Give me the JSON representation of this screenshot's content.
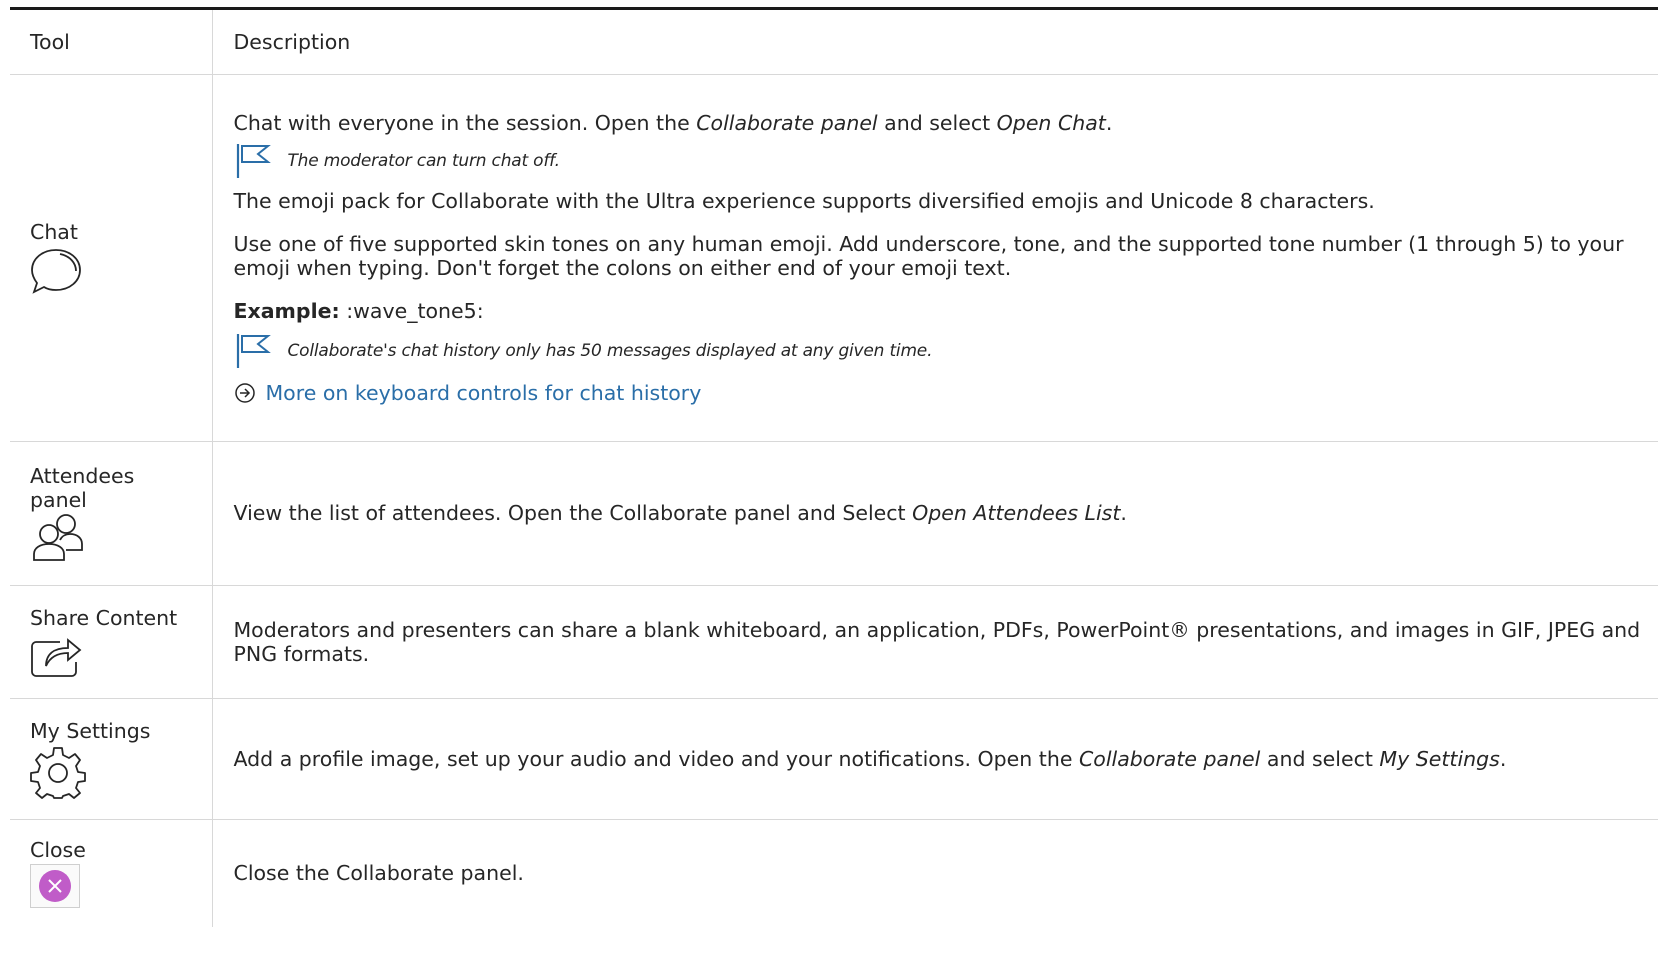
{
  "table": {
    "headers": {
      "tool": "Tool",
      "description": "Description"
    },
    "chat": {
      "tool": "Chat",
      "p1_a": "Chat with everyone in the session. Open the ",
      "p1_b": "Collaborate panel",
      "p1_c": " and select ",
      "p1_d": "Open Chat",
      "p1_e": ".",
      "note1": "The moderator can turn chat off.",
      "p2": "The emoji pack for Collaborate with the Ultra experience supports diversified emojis and Unicode 8 characters.",
      "p3": "Use one of five supported skin tones on any human emoji. Add underscore, tone, and the supported tone number (1 through 5) to your emoji when typing. Don't forget the colons on either end of your emoji text.",
      "example_label": "Example:",
      "example_value": " :wave_tone5:",
      "note2": "Collaborate's chat history only has 50 messages displayed at any given time.",
      "link": "More on keyboard controls for chat history"
    },
    "attendees": {
      "tool_line1": "Attendees",
      "tool_line2": "panel",
      "desc_a": "View the list of attendees. Open the Collaborate panel and Select ",
      "desc_b": "Open Attendees List",
      "desc_c": "."
    },
    "share": {
      "tool": "Share Content",
      "desc": "Moderators and presenters can share a blank whiteboard, an application, PDFs, PowerPoint® presentations, and images in GIF, JPEG and PNG formats."
    },
    "settings": {
      "tool": "My Settings",
      "desc_a": "Add a profile image, set up your audio and video and your notifications. Open the ",
      "desc_b": "Collaborate panel",
      "desc_c": " and select ",
      "desc_d": "My Settings",
      "desc_e": "."
    },
    "close": {
      "tool": "Close",
      "desc": "Close the Collaborate panel."
    }
  },
  "icons": [
    "chat-bubble-icon",
    "attendees-icon",
    "share-content-icon",
    "settings-gear-icon",
    "close-icon",
    "flag-icon",
    "circle-arrow-right-icon"
  ],
  "colors": {
    "link": "#2a6ea8",
    "flag": "#2a6ea8",
    "close_accent": "#c05cc8",
    "rule": "#1a1a1a",
    "divider": "#d8d8d8"
  }
}
